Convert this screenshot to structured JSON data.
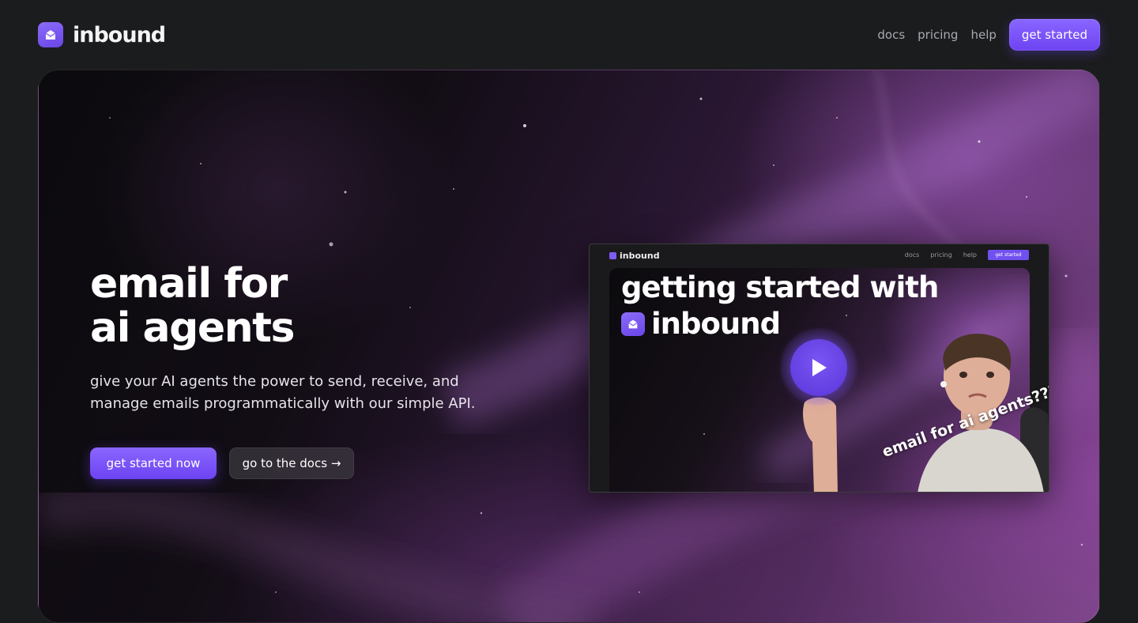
{
  "header": {
    "brand_name": "inbound",
    "nav": {
      "docs": "docs",
      "pricing": "pricing",
      "help": "help",
      "cta": "get started"
    }
  },
  "hero": {
    "title_line1": "email for",
    "title_line2": "ai agents",
    "subtitle": "give your AI agents the power to send, receive, and manage emails programmatically with our simple API.",
    "primary_cta": "get started now",
    "secondary_cta": "go to the docs →"
  },
  "video": {
    "mini_brand": "inbound",
    "mini_nav": {
      "docs": "docs",
      "pricing": "pricing",
      "help": "help",
      "cta": "get started"
    },
    "title_line1": "getting started with",
    "title_line2": "inbound",
    "caption": "email for ai agents???"
  },
  "colors": {
    "accent": "#7c58f6",
    "background": "#1b1c1e"
  },
  "icons": {
    "brand": "envelope-icon",
    "play": "play-icon"
  }
}
